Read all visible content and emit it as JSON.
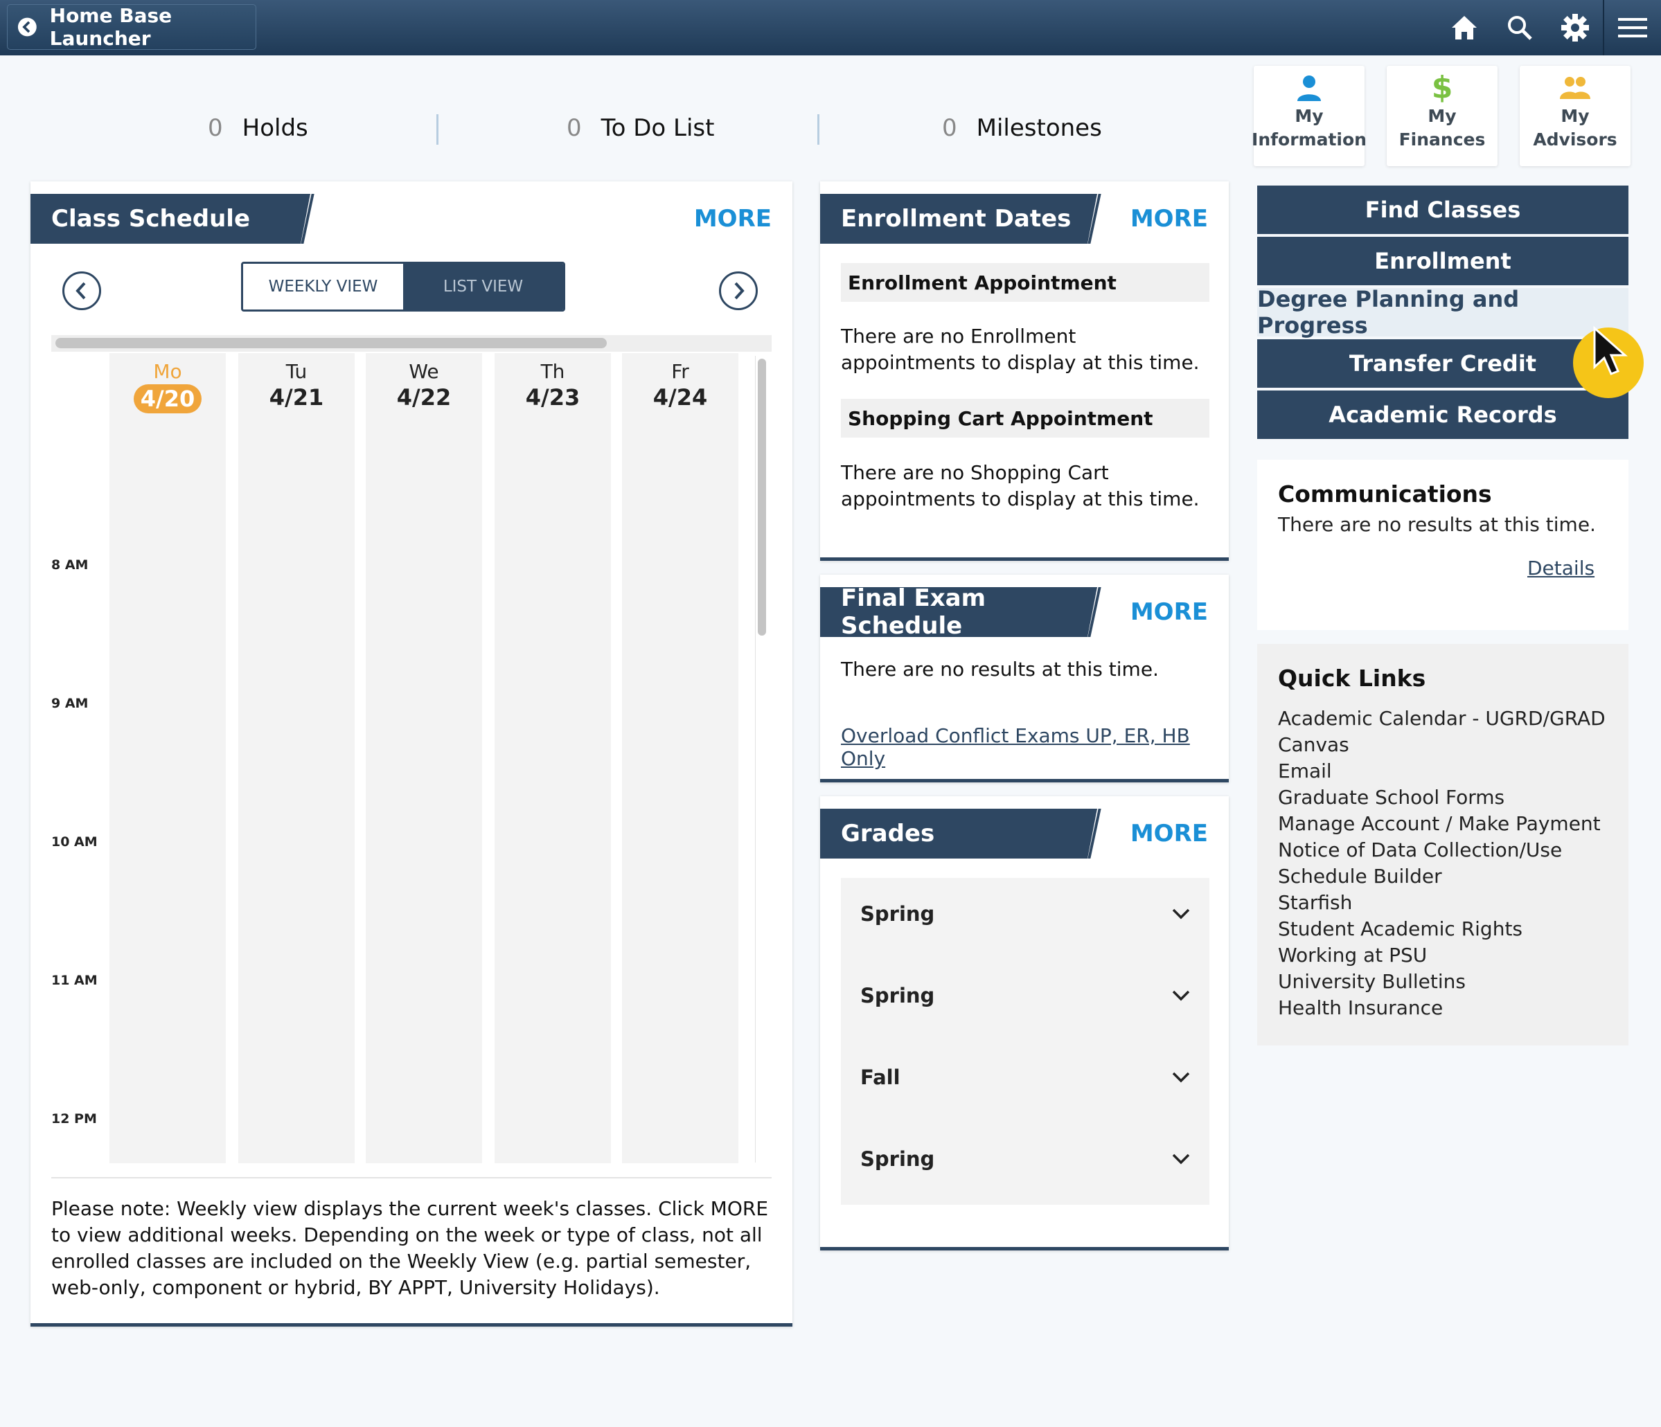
{
  "topbar": {
    "back_label": "Home Base Launcher",
    "icons": [
      "home-icon",
      "search-icon",
      "gear-icon",
      "hamburger-menu-icon"
    ]
  },
  "counters": [
    {
      "count": "0",
      "label": "Holds"
    },
    {
      "count": "0",
      "label": "To Do List"
    },
    {
      "count": "0",
      "label": "Milestones"
    }
  ],
  "tiles": [
    {
      "line1": "My",
      "line2": "Information",
      "icon": "person-icon",
      "color": "#1a8fd6"
    },
    {
      "line1": "My",
      "line2": "Finances",
      "icon": "dollar-icon",
      "color": "#7ac142"
    },
    {
      "line1": "My",
      "line2": "Advisors",
      "icon": "people-icon",
      "color": "#f0b83a"
    }
  ],
  "class_schedule": {
    "title": "Class Schedule",
    "more": "MORE",
    "view_weekly": "WEEKLY VIEW",
    "view_list": "LIST VIEW",
    "days": [
      {
        "name": "Mo",
        "date": "4/20",
        "today": true
      },
      {
        "name": "Tu",
        "date": "4/21"
      },
      {
        "name": "We",
        "date": "4/22"
      },
      {
        "name": "Th",
        "date": "4/23"
      },
      {
        "name": "Fr",
        "date": "4/24"
      }
    ],
    "times": [
      "8 AM",
      "9 AM",
      "10 AM",
      "11 AM",
      "12 PM"
    ],
    "note": "Please note: Weekly view displays the current week's classes. Click MORE to view additional weeks. Depending on the week or type of class, not all enrolled classes are included on the Weekly View (e.g. partial semester, web-only, component or hybrid, BY APPT, University Holidays)."
  },
  "enrollment_dates": {
    "title": "Enrollment Dates",
    "more": "MORE",
    "enroll_appt_head": "Enrollment Appointment",
    "enroll_appt_text": "There are no Enrollment appointments to display at this time.",
    "cart_appt_head": "Shopping Cart Appointment",
    "cart_appt_text": "There are no Shopping Cart appointments to display at this time."
  },
  "final_exam": {
    "title": "Final Exam Schedule",
    "more": "MORE",
    "text": "There are no results at this time.",
    "link": "Overload Conflict Exams UP, ER, HB Only"
  },
  "grades": {
    "title": "Grades",
    "more": "MORE",
    "terms": [
      "Spring",
      "Spring",
      "Fall",
      "Spring"
    ]
  },
  "nav": [
    {
      "label": "Find Classes"
    },
    {
      "label": "Enrollment"
    },
    {
      "label": "Degree Planning and Progress",
      "active": true
    },
    {
      "label": "Transfer Credit"
    },
    {
      "label": "Academic Records"
    }
  ],
  "communications": {
    "title": "Communications",
    "text": "There are no results at this time.",
    "link": "Details"
  },
  "quick_links": {
    "title": "Quick Links",
    "items": [
      "Academic Calendar - UGRD/GRAD",
      "Canvas",
      "Email",
      "Graduate School Forms",
      "Manage Account / Make Payment",
      "Notice of Data Collection/Use",
      "Schedule Builder",
      "Starfish",
      "Student Academic Rights",
      "Working at PSU",
      "University Bulletins",
      "Health Insurance"
    ]
  },
  "colors": {
    "header": "#2e4762",
    "accent": "#1a8fd6",
    "today": "#f0a53b",
    "cursor_highlight": "#f5c518"
  }
}
